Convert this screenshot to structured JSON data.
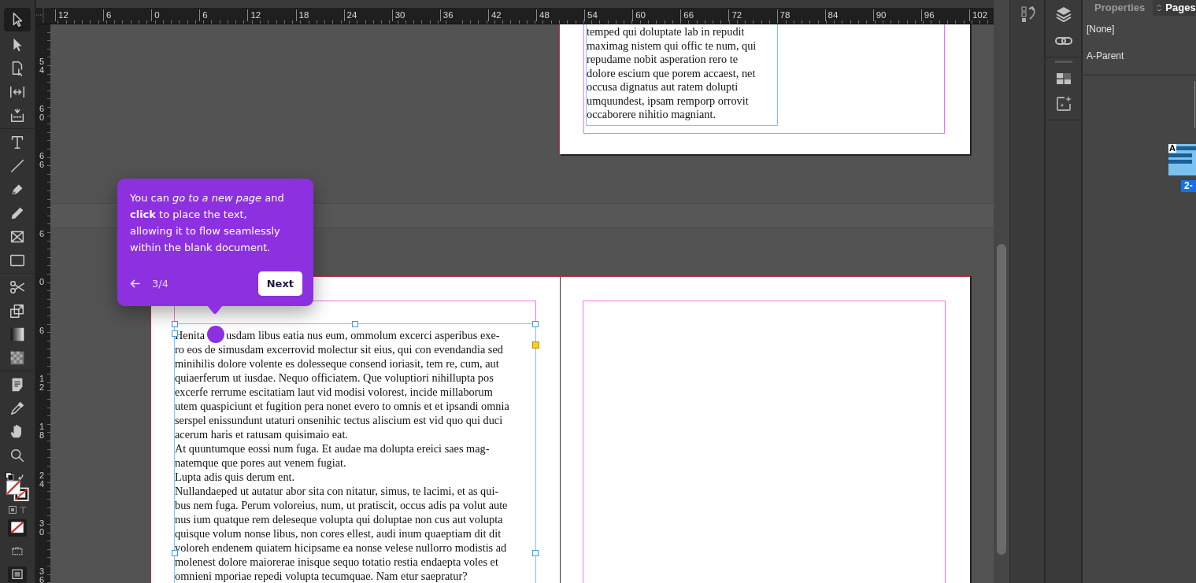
{
  "rulers": {
    "horizontal": [
      "12",
      "6",
      "0",
      "6",
      "12",
      "18",
      "24",
      "30",
      "36",
      "42",
      "48",
      "54",
      "60",
      "66",
      "72",
      "78",
      "84",
      "90",
      "96",
      "102"
    ],
    "vertical_upper": [
      "54",
      "60",
      "66"
    ],
    "vertical_lower": [
      "6",
      "0",
      "6",
      "12",
      "18",
      "24",
      "30",
      "36"
    ]
  },
  "tools": [
    {
      "kind": "selection",
      "selected": true
    },
    {
      "kind": "direct-selection",
      "selected": false
    },
    {
      "kind": "page",
      "selected": false
    },
    {
      "kind": "gap",
      "selected": false
    },
    {
      "kind": "content-collector",
      "selected": false
    },
    {
      "kind": "type",
      "selected": false
    },
    {
      "kind": "line",
      "selected": false
    },
    {
      "kind": "pen",
      "selected": false
    },
    {
      "kind": "pencil",
      "selected": false
    },
    {
      "kind": "frame",
      "selected": false
    },
    {
      "kind": "rectangle",
      "selected": false
    },
    {
      "kind": "scissors",
      "selected": false
    },
    {
      "kind": "transform",
      "selected": false
    },
    {
      "kind": "gradient",
      "selected": false
    },
    {
      "kind": "feather",
      "selected": false
    },
    {
      "kind": "note",
      "selected": false
    },
    {
      "kind": "eyedropper",
      "selected": false
    },
    {
      "kind": "hand",
      "selected": false
    },
    {
      "kind": "zoom",
      "selected": false
    }
  ],
  "top_page": {
    "lines": [
      "temped qui doluptate lab in repudit",
      "maximag nistem qui offic te num, qui",
      "repudame nobit asperation rero te",
      "dolore escium que porem accaest, net",
      "occusa dignatus aut ratem dolupti",
      "umquundest, ipsam remporp orrovit",
      "occaborere nihitio magniant."
    ]
  },
  "bottom_page": {
    "first_line_parts": [
      "Henita",
      "usdam libus eatia nus eum, ommolum excerci asperibus exe-"
    ],
    "lines": [
      "ro eos de simusdam excerrovid molectur sit eius, qui con evendandia sed",
      "minihilis dolore volente es dolesseque consend ioriasit, tem re, cum, aut",
      "quiaerferum ut iusdae. Nequo officiatem. Que voluptiori nihillupta pos",
      "excerfe rerrume escitatiam laut vid modisi volorest, incide millaborum",
      "utem quaspiciunt et fugition pera nonet evero to omnis et et ipsandi omnia",
      "serspel enissundunt utaturi onsenihic tectus aliscium est vid quo qui duci",
      "acerum haris et ratusam quisimaio eat.",
      "At quuntumque eossi num fuga. Et audae ma dolupta ereici saes mag-",
      "natemque que pores aut venem fugiat.",
      "Lupta adis quis derum ent.",
      "Nullandaeped ut autatur abor sita con nitatur, simus, te lacimi, et as qui-",
      "bus nem fuga. Perum voloreius, num, ut pratiscit, occus adis pa volut aute",
      "nus ium quatque rem deleseque volupta qui doluptae non cus aut volupta",
      "quisque volum nonse libus, non cores ellest, audi inum quaeptiam dit dit",
      "voloreh endenem quiatem hicipsame ea nonse velese nullorro modistis ad",
      "molenest dolore maiorerae inisque sequo totatio restia endaepta voles et",
      "omnieni mporiae repedi volupta tecumquae. Nam etur saepratur?"
    ]
  },
  "coachmark": {
    "message": "You can *go to a new page* and **click** to place the text, allowing it to flow seamlessly within the blank document.",
    "step": "3/4",
    "next": "Next"
  },
  "panel": {
    "tabs": [
      {
        "label": "Properties",
        "selected": false
      },
      {
        "label": "Pages",
        "selected": true
      }
    ],
    "parents": [
      "[None]",
      "A-Parent"
    ],
    "thumb_prefix": "A",
    "page_badge": "2-"
  }
}
